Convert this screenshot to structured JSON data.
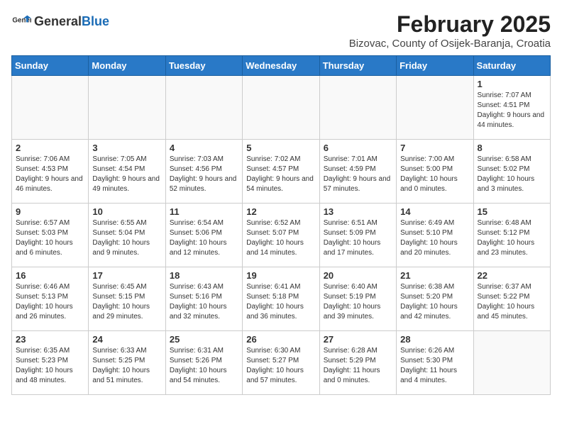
{
  "header": {
    "logo_general": "General",
    "logo_blue": "Blue",
    "month_year": "February 2025",
    "location": "Bizovac, County of Osijek-Baranja, Croatia"
  },
  "weekdays": [
    "Sunday",
    "Monday",
    "Tuesday",
    "Wednesday",
    "Thursday",
    "Friday",
    "Saturday"
  ],
  "weeks": [
    [
      {
        "day": "",
        "text": ""
      },
      {
        "day": "",
        "text": ""
      },
      {
        "day": "",
        "text": ""
      },
      {
        "day": "",
        "text": ""
      },
      {
        "day": "",
        "text": ""
      },
      {
        "day": "",
        "text": ""
      },
      {
        "day": "1",
        "text": "Sunrise: 7:07 AM\nSunset: 4:51 PM\nDaylight: 9 hours and 44 minutes."
      }
    ],
    [
      {
        "day": "2",
        "text": "Sunrise: 7:06 AM\nSunset: 4:53 PM\nDaylight: 9 hours and 46 minutes."
      },
      {
        "day": "3",
        "text": "Sunrise: 7:05 AM\nSunset: 4:54 PM\nDaylight: 9 hours and 49 minutes."
      },
      {
        "day": "4",
        "text": "Sunrise: 7:03 AM\nSunset: 4:56 PM\nDaylight: 9 hours and 52 minutes."
      },
      {
        "day": "5",
        "text": "Sunrise: 7:02 AM\nSunset: 4:57 PM\nDaylight: 9 hours and 54 minutes."
      },
      {
        "day": "6",
        "text": "Sunrise: 7:01 AM\nSunset: 4:59 PM\nDaylight: 9 hours and 57 minutes."
      },
      {
        "day": "7",
        "text": "Sunrise: 7:00 AM\nSunset: 5:00 PM\nDaylight: 10 hours and 0 minutes."
      },
      {
        "day": "8",
        "text": "Sunrise: 6:58 AM\nSunset: 5:02 PM\nDaylight: 10 hours and 3 minutes."
      }
    ],
    [
      {
        "day": "9",
        "text": "Sunrise: 6:57 AM\nSunset: 5:03 PM\nDaylight: 10 hours and 6 minutes."
      },
      {
        "day": "10",
        "text": "Sunrise: 6:55 AM\nSunset: 5:04 PM\nDaylight: 10 hours and 9 minutes."
      },
      {
        "day": "11",
        "text": "Sunrise: 6:54 AM\nSunset: 5:06 PM\nDaylight: 10 hours and 12 minutes."
      },
      {
        "day": "12",
        "text": "Sunrise: 6:52 AM\nSunset: 5:07 PM\nDaylight: 10 hours and 14 minutes."
      },
      {
        "day": "13",
        "text": "Sunrise: 6:51 AM\nSunset: 5:09 PM\nDaylight: 10 hours and 17 minutes."
      },
      {
        "day": "14",
        "text": "Sunrise: 6:49 AM\nSunset: 5:10 PM\nDaylight: 10 hours and 20 minutes."
      },
      {
        "day": "15",
        "text": "Sunrise: 6:48 AM\nSunset: 5:12 PM\nDaylight: 10 hours and 23 minutes."
      }
    ],
    [
      {
        "day": "16",
        "text": "Sunrise: 6:46 AM\nSunset: 5:13 PM\nDaylight: 10 hours and 26 minutes."
      },
      {
        "day": "17",
        "text": "Sunrise: 6:45 AM\nSunset: 5:15 PM\nDaylight: 10 hours and 29 minutes."
      },
      {
        "day": "18",
        "text": "Sunrise: 6:43 AM\nSunset: 5:16 PM\nDaylight: 10 hours and 32 minutes."
      },
      {
        "day": "19",
        "text": "Sunrise: 6:41 AM\nSunset: 5:18 PM\nDaylight: 10 hours and 36 minutes."
      },
      {
        "day": "20",
        "text": "Sunrise: 6:40 AM\nSunset: 5:19 PM\nDaylight: 10 hours and 39 minutes."
      },
      {
        "day": "21",
        "text": "Sunrise: 6:38 AM\nSunset: 5:20 PM\nDaylight: 10 hours and 42 minutes."
      },
      {
        "day": "22",
        "text": "Sunrise: 6:37 AM\nSunset: 5:22 PM\nDaylight: 10 hours and 45 minutes."
      }
    ],
    [
      {
        "day": "23",
        "text": "Sunrise: 6:35 AM\nSunset: 5:23 PM\nDaylight: 10 hours and 48 minutes."
      },
      {
        "day": "24",
        "text": "Sunrise: 6:33 AM\nSunset: 5:25 PM\nDaylight: 10 hours and 51 minutes."
      },
      {
        "day": "25",
        "text": "Sunrise: 6:31 AM\nSunset: 5:26 PM\nDaylight: 10 hours and 54 minutes."
      },
      {
        "day": "26",
        "text": "Sunrise: 6:30 AM\nSunset: 5:27 PM\nDaylight: 10 hours and 57 minutes."
      },
      {
        "day": "27",
        "text": "Sunrise: 6:28 AM\nSunset: 5:29 PM\nDaylight: 11 hours and 0 minutes."
      },
      {
        "day": "28",
        "text": "Sunrise: 6:26 AM\nSunset: 5:30 PM\nDaylight: 11 hours and 4 minutes."
      },
      {
        "day": "",
        "text": ""
      }
    ]
  ]
}
